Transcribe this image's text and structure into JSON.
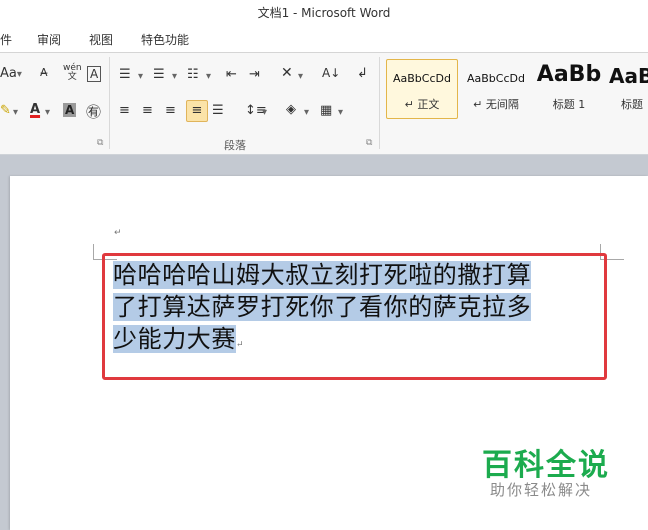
{
  "window": {
    "title": "文档1 - Microsoft Word"
  },
  "menu": {
    "items": [
      "件",
      "审阅",
      "视图",
      "特色功能"
    ]
  },
  "ribbon": {
    "font_row1": [
      "Aa",
      "wén",
      "A"
    ],
    "paragraph_group_label": "段落",
    "styles": [
      {
        "sample": "AaBbCcDd",
        "name": "↵ 正文",
        "selected": true
      },
      {
        "sample": "AaBbCcDd",
        "name": "↵ 无间隔",
        "selected": false
      },
      {
        "sample": "AaBb",
        "name": "标题 1",
        "selected": false
      },
      {
        "sample": "AaBl",
        "name": "标题",
        "selected": false
      }
    ]
  },
  "document": {
    "paragraph_mark": "↵",
    "lines": [
      "哈哈哈哈山姆大叔立刻打死啦的撒打算",
      "了打算达萨罗打死你了看你的萨克拉多",
      "少能力大赛"
    ]
  },
  "watermark": {
    "title": "百科全说",
    "subtitle": "助你轻松解决"
  }
}
